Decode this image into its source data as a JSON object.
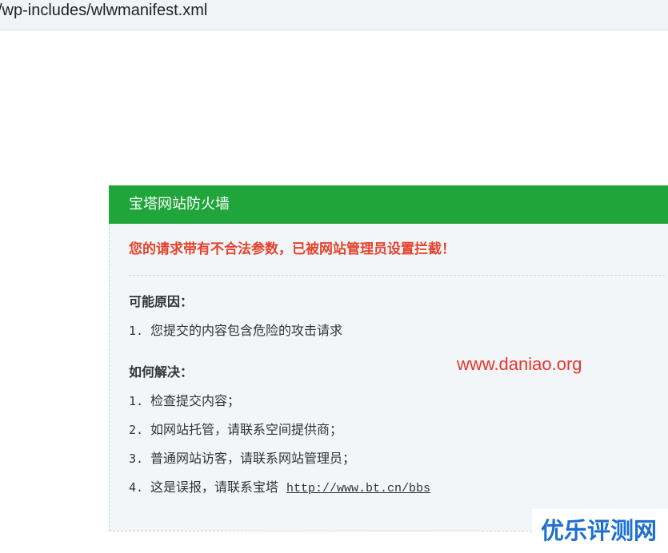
{
  "address_bar": {
    "url": "/wp-includes/wlwmanifest.xml"
  },
  "firewall": {
    "title": "宝塔网站防火墙",
    "message": "您的请求带有不合法参数，已被网站管理员设置拦截！",
    "reasons_heading": "可能原因：",
    "reasons": [
      {
        "num": "1.",
        "text": "您提交的内容包含危险的攻击请求"
      }
    ],
    "solutions_heading": "如何解决：",
    "solutions": [
      {
        "num": "1.",
        "text": "检查提交内容；"
      },
      {
        "num": "2.",
        "text": "如网站托管，请联系空间提供商；"
      },
      {
        "num": "3.",
        "text": "普通网站访客，请联系网站管理员；"
      },
      {
        "num": "4.",
        "text": "这是误报，请联系宝塔",
        "link": "http://www.bt.cn/bbs"
      }
    ]
  },
  "watermarks": {
    "site": "www.daniao.org",
    "brand": "优乐评测网"
  },
  "colors": {
    "header_green": "#20a53a",
    "alert_red": "#e4432d",
    "watermark_red": "#e8342c",
    "brand_blue": "#1d6fd2",
    "panel_bg": "#f3f6f8"
  }
}
